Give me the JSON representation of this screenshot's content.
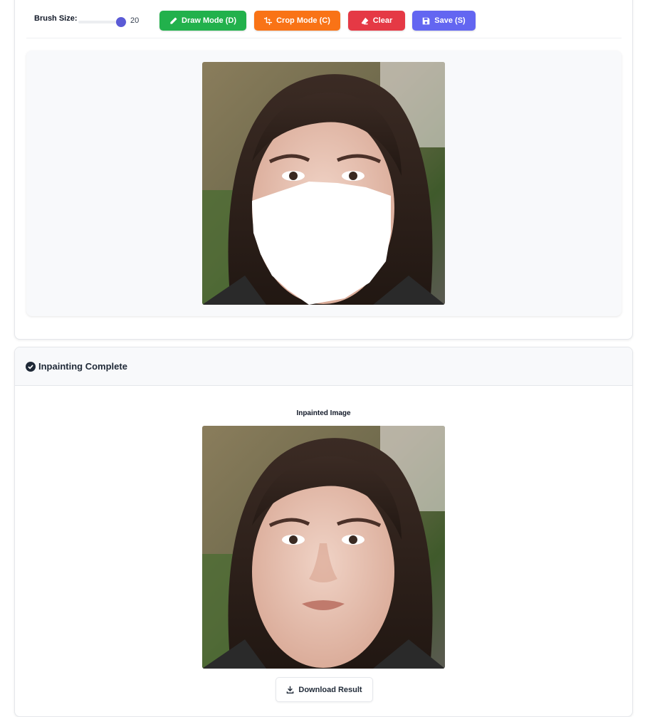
{
  "toolbar": {
    "brush_label": "Brush Size:",
    "brush_value": "20",
    "brush_level_percent": 100,
    "draw_label": "Draw Mode (D)",
    "crop_label": "Crop Mode (C)",
    "clear_label": "Clear",
    "save_label": "Save (S)"
  },
  "colors": {
    "draw": "#22b14c",
    "crop": "#f97316",
    "clear": "#e53945",
    "save": "#6366f1",
    "slider_thumb": "#5b5bd6"
  },
  "editor": {
    "image_icon": "portrait-photo-with-mask",
    "mask_color": "#ffffff"
  },
  "result": {
    "header_title": "Inpainting Complete",
    "header_icon": "check-circle-icon",
    "image_label": "Inpainted Image",
    "image_icon": "portrait-photo",
    "download_label": "Download Result",
    "download_icon": "download-icon"
  }
}
